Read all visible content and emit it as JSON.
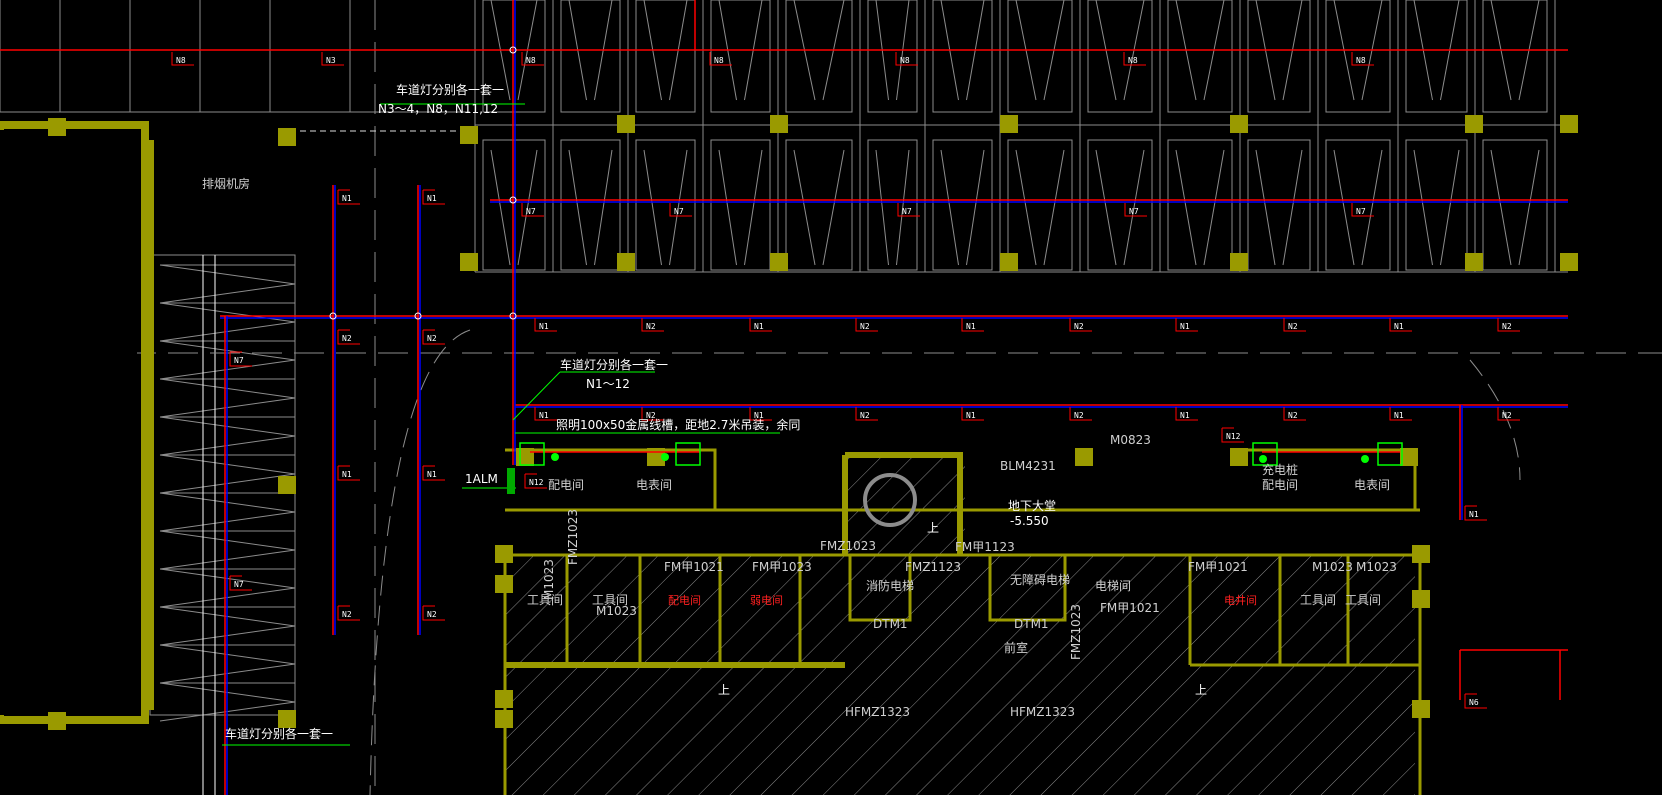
{
  "drawing": {
    "colors": {
      "background": "#000000",
      "wall": "#9a9a00",
      "circuit": "#ff0000",
      "bus": "#0000ff",
      "annotation": "#00ff00",
      "linework": "#8c8c8c"
    },
    "top_bus_labels": [
      "N8",
      "N3",
      "N8",
      "N8",
      "N8",
      "N8",
      "N8"
    ],
    "second_bus_labels": [
      "N7",
      "N7",
      "N7",
      "N7",
      "N7"
    ],
    "third_bus_labels": [
      "N1",
      "N2",
      "N1",
      "N2",
      "N1",
      "N2",
      "N1",
      "N2",
      "N1",
      "N2"
    ],
    "fourth_bus_labels": [
      "N1",
      "N2",
      "N1",
      "N2",
      "N1",
      "N2",
      "N1",
      "N2",
      "N1",
      "N2"
    ],
    "vertical_bus_a_labels": [
      "N1",
      "N2",
      "N1",
      "N2"
    ],
    "vertical_bus_b_labels": [
      "N1",
      "N2",
      "N1",
      "N2"
    ],
    "misc_circuit_labels": [
      "N7",
      "N7",
      "N12",
      "N12",
      "N1",
      "N6"
    ],
    "notes": {
      "lane_light_1": "车道灯分别各一套一",
      "lane_light_1_circuits": "N3～4，N8，N11,12",
      "lane_light_2": "车道灯分别各一套一",
      "lane_light_2_circuits": "N1～12",
      "trunking": "照明100x50金属线槽，距地2.7米吊装，余同",
      "lane_light_3": "车道灯分别各一套一",
      "panel": "1ALM"
    },
    "rooms": {
      "smoke_exhaust": "排烟机房",
      "distribution_1": "配电间",
      "meter_1": "电表间",
      "charging": "充电桩",
      "distribution_2": "配电间",
      "meter_2": "电表间",
      "lobby": "地下大堂",
      "level": "-5.550",
      "tool_1": "工具间",
      "tool_2": "工具间",
      "red_room_1": "配电间",
      "red_room_2": "弱电间",
      "red_room_3": "电井间",
      "tool_3": "工具间",
      "tool_4": "工具间",
      "corridor": "前室",
      "elevator_1": "消防电梯",
      "elevator_2": "无障碍电梯",
      "room_right": "电梯间",
      "stair_up_1": "上",
      "stair_up_2": "上",
      "stair_up_3": "上"
    },
    "doors": [
      "BLM4231",
      "M0823",
      "FMZ1023",
      "FMZ1023",
      "FM甲1021",
      "FM甲1023",
      "FMZ1123",
      "FM甲1123",
      "FM甲1021",
      "M1023",
      "M1023",
      "FM甲1021",
      "DTM1",
      "DTM1",
      "HFMZ1323",
      "HFMZ1323",
      "M1023",
      "M1023",
      "FMZ1023"
    ]
  }
}
